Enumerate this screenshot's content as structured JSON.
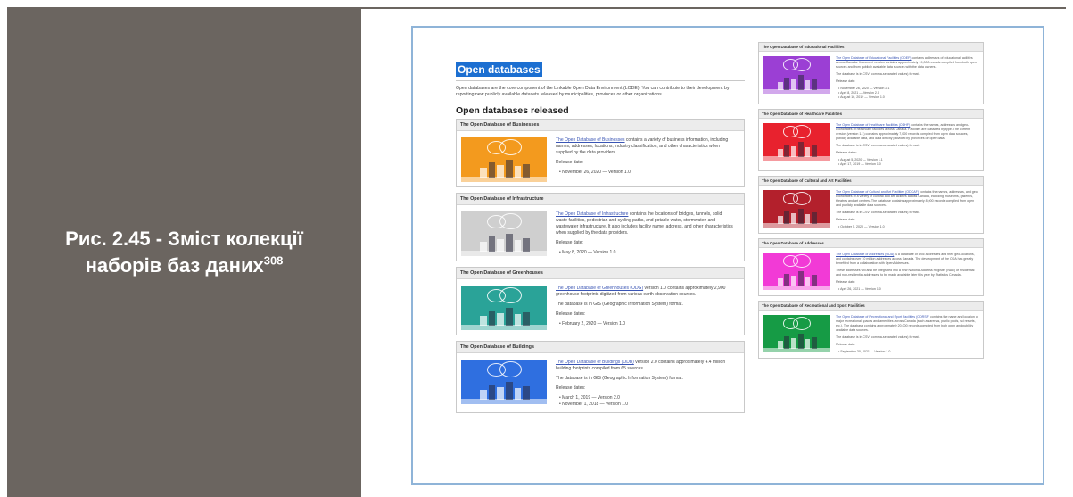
{
  "caption": {
    "line1": "Рис. 2.45 - Зміст колекції",
    "line2": "наборів баз даних",
    "footnote": "308"
  },
  "page": {
    "title": "Open databases",
    "intro": "Open databases are the core component of the Linkable Open Data Environment (LODE). You can contribute to their development by reporting new publicly available datasets released by municipalities, provinces or other organizations.",
    "section_title": "Open databases released"
  },
  "colors": {
    "caption_panel": "#6b6560",
    "title_highlight": "#1c6fd1",
    "frame_border": "#8fb4d8",
    "link": "#3a55b4"
  },
  "left_cards": [
    {
      "title": "The Open Database of Businesses",
      "link": "The Open Database of Businesses",
      "desc": " contains a variety of business information, including names, addresses, locations, industry classification, and other characteristics when supplied by the data providers.",
      "extra": "",
      "release_label": "Release date:",
      "releases": [
        "November 26, 2020 — Version 1.0"
      ],
      "image_color": "#f39a1e"
    },
    {
      "title": "The Open Database of Infrastructure",
      "link": "The Open Database of Infrastructure",
      "desc": " contains the locations of bridges, tunnels, solid waste facilities, pedestrian and cycling paths, and potable water, stormwater, and wastewater infrastructure. It also includes facility name, address, and other characteristics when supplied by the data providers.",
      "extra": "",
      "release_label": "Release date:",
      "releases": [
        "May 8, 2020 — Version 1.0"
      ],
      "image_color": "#cfcfcf"
    },
    {
      "title": "The Open Database of Greenhouses",
      "link": "The Open Database of Greenhouses (ODG)",
      "desc": " version 1.0 contains approximately 2,900 greenhouse footprints digitized from various earth observation sources.",
      "extra": "The database is in GIS (Geographic Information System) format.",
      "release_label": "Release dates:",
      "releases": [
        "February 2, 2020 — Version 1.0"
      ],
      "image_color": "#2aa398"
    },
    {
      "title": "The Open Database of Buildings",
      "link": "The Open Database of Buildings (ODB)",
      "desc": " version 2.0 contains approximately 4.4 million building footprints compiled from 65 sources.",
      "extra": "The database is in GIS (Geographic Information System) format.",
      "release_label": "Release dates:",
      "releases": [
        "March 1, 2019 — Version 2.0",
        "November 1, 2018 — Version 1.0"
      ],
      "image_color": "#2f6fe0"
    }
  ],
  "right_cards": [
    {
      "title": "The Open Database of Educational Facilities",
      "link": "The Open Database of Educational Facilities (ODEF)",
      "desc": " contains addresses of educational facilities across Canada. Its current version contains approximately 19,000 records compiled from both open sources and from publicly available data sources with the data owners.",
      "extra": "The database is in CSV (comma-separated values) format.",
      "release_label": "Release date:",
      "releases": [
        "November 26, 2020 — Version 2.1",
        "April 8, 2021 — Version 2.0",
        "August 16, 2019 — Version 1.0"
      ],
      "image_color": "#9b3fd4"
    },
    {
      "title": "The Open Database of Healthcare Facilities",
      "link": "The Open Database of Healthcare Facilities (ODHF)",
      "desc": " contains the names, addresses and geo-coordinates of healthcare facilities across Canada. Facilities are classified by type. The current version (version 1.1) contains approximately 7,000 records compiled from open data sources, publicly available data, and data directly provided by provinces on open data.",
      "extra": "The database is in CSV (comma-separated values) format.",
      "release_label": "Release dates:",
      "releases": [
        "August 5, 2020 — Version 1.1",
        "April 17, 2019 — Version 1.0"
      ],
      "image_color": "#e8222e"
    },
    {
      "title": "The Open Database of Cultural and Art Facilities",
      "link": "The Open Database of Cultural and Art Facilities (ODCAF)",
      "desc": " contains the names, addresses, and geo-coordinates of a variety of cultural and art facilities across Canada, including museums, galleries, theatres and art centres. The database contains approximately 8,000 records compiled from open and publicly available data sources.",
      "extra": "The database is in CSV (comma-separated values) format.",
      "release_label": "Release date:",
      "releases": [
        "October 5, 2020 — Version 1.0"
      ],
      "image_color": "#b3202c"
    },
    {
      "title": "The Open Database of Addresses",
      "link": "The Open Database of Addresses (ODA)",
      "desc": " is a database of civic addresses and their geo-locations, and contains over 10 million addresses across Canada. The development of the ODA has greatly benefited from a collaboration with OpenAddresses.",
      "extra": "These addresses will also be integrated into a new National Address Register (NAR) of residential and non-residential addresses, to be made available later this year by Statistics Canada.",
      "release_label": "Release date:",
      "releases": [
        "April 26, 2021 — Version 1.0"
      ],
      "image_color": "#f23ad6"
    },
    {
      "title": "The Open Database of Recreational and Sport Facilities",
      "link": "The Open Database of Recreational and Sport Facilities (ODRSF)",
      "desc": " contains the name and location of major recreational spaces and amenities across Canada (such as arenas, public pools, ski resorts, etc.). The database contains approximately 20,000 records compiled from both open and publicly available data sources.",
      "extra": "The database is in CSV (comma-separated values) format.",
      "release_label": "Release date:",
      "releases": [
        "September 30, 2021 — Version 1.0"
      ],
      "image_color": "#169b45"
    }
  ]
}
